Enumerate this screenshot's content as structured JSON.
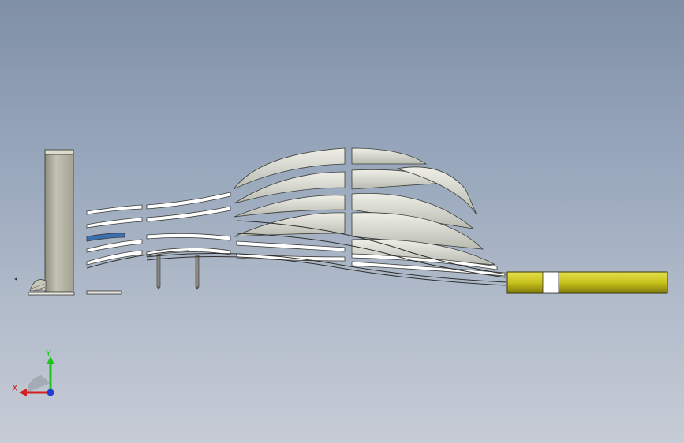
{
  "viewport": {
    "background_top": "#7f8fa6",
    "background_bottom": "#c7ccd6"
  },
  "model": {
    "blade_fill": "#d6d8cf",
    "blade_edge": "#ffffff",
    "cut_fill": "#ffffff",
    "handle_color": "#c8c21c",
    "post_fill": "#b9b8a6",
    "accent_blue": "#3a6fb0"
  },
  "triad": {
    "x_label": "X",
    "y_label": "Y",
    "x_color": "#d42020",
    "y_color": "#1ec31e",
    "z_color": "#1f3fd1",
    "icon": "coordinate-triad-icon"
  }
}
